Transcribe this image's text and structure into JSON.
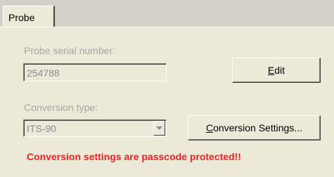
{
  "tabs": {
    "probe": "Probe"
  },
  "serial": {
    "label": "Probe serial number:",
    "value": "254788"
  },
  "edit_button": {
    "prefix": "",
    "mnemonic": "E",
    "suffix": "dit"
  },
  "conversion": {
    "label": "Conversion type:",
    "value": "ITS-90"
  },
  "settings_button": {
    "prefix": "",
    "mnemonic": "C",
    "suffix": "onversion Settings..."
  },
  "warning": "Conversion settings are passcode protected!!",
  "colors": {
    "warning": "#ee2020",
    "disabled_text": "#a6a6a6",
    "panel": "#ece9d8"
  },
  "icons": {
    "dropdown": "chevron-down-icon"
  }
}
